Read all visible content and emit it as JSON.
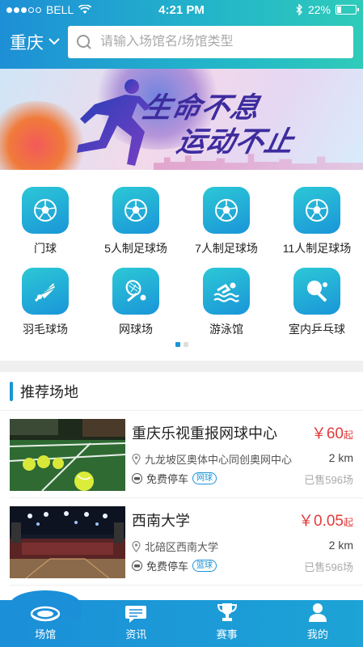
{
  "status_bar": {
    "carrier": "BELL",
    "time": "4:21 PM",
    "battery": "22%",
    "battery_level": 0.22
  },
  "header": {
    "city": "重庆",
    "search_placeholder": "请输入场馆名/场馆类型"
  },
  "banner": {
    "slogan_line1": "生命不息",
    "slogan_line2": "运动不止"
  },
  "categories": [
    {
      "label": "门球",
      "icon": "soccer-ball-icon"
    },
    {
      "label": "5人制足球场",
      "icon": "soccer-ball-icon"
    },
    {
      "label": "7人制足球场",
      "icon": "soccer-ball-icon"
    },
    {
      "label": "11人制足球场",
      "icon": "soccer-ball-icon"
    },
    {
      "label": "羽毛球场",
      "icon": "shuttlecock-icon"
    },
    {
      "label": "网球场",
      "icon": "tennis-racket-icon"
    },
    {
      "label": "游泳馆",
      "icon": "swimming-icon"
    },
    {
      "label": "室内乒乓球",
      "icon": "ping-pong-icon"
    }
  ],
  "pager": {
    "current": 1,
    "total": 2
  },
  "recommend": {
    "title": "推荐场地",
    "venues": [
      {
        "name": "重庆乐视重报网球中心",
        "price": "￥60",
        "price_suffix": "起",
        "address": "九龙坡区奥体中心同创奥网中心",
        "distance": "2 km",
        "parking": "免费停车",
        "tag": "网球",
        "sold": "已售596场"
      },
      {
        "name": "西南大学",
        "price": "￥0.05",
        "price_suffix": "起",
        "address": "北碚区西南大学",
        "distance": "2 km",
        "parking": "免费停车",
        "tag": "篮球",
        "sold": "已售596场"
      }
    ]
  },
  "tabbar": [
    {
      "label": "场馆",
      "icon": "stadium-icon",
      "active": true
    },
    {
      "label": "资讯",
      "icon": "news-icon",
      "active": false
    },
    {
      "label": "赛事",
      "icon": "trophy-icon",
      "active": false
    },
    {
      "label": "我的",
      "icon": "user-icon",
      "active": false
    }
  ],
  "colors": {
    "primary": "#1a95d8",
    "accent_teal": "#2cc8d6",
    "price_red": "#e23a3a"
  }
}
